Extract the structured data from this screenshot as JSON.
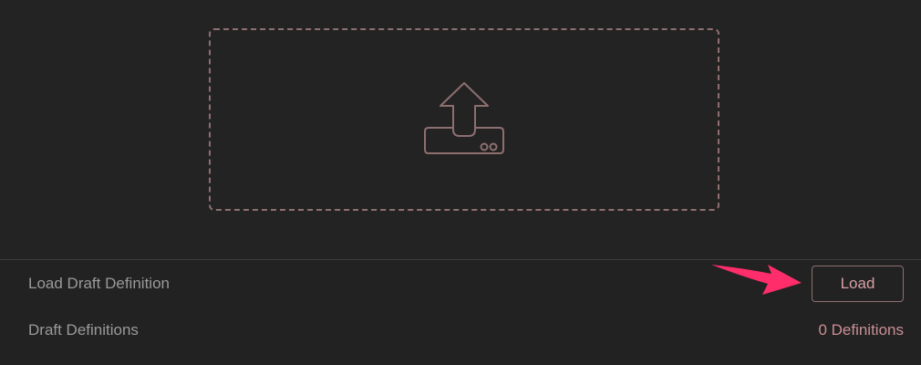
{
  "dropzone": {
    "icon": "upload-tray-icon"
  },
  "rows": {
    "load_label": "Load Draft Definition",
    "definitions_label": "Draft Definitions"
  },
  "actions": {
    "load_button_label": "Load"
  },
  "status": {
    "definitions_count": "0 Definitions"
  },
  "annotation": {
    "icon": "arrow-pointer-icon",
    "color": "#ff2d6a"
  },
  "colors": {
    "background": "#222222",
    "accent": "#c98f94",
    "border_accent": "#8e6f70",
    "label_text": "#9a9a9a"
  }
}
